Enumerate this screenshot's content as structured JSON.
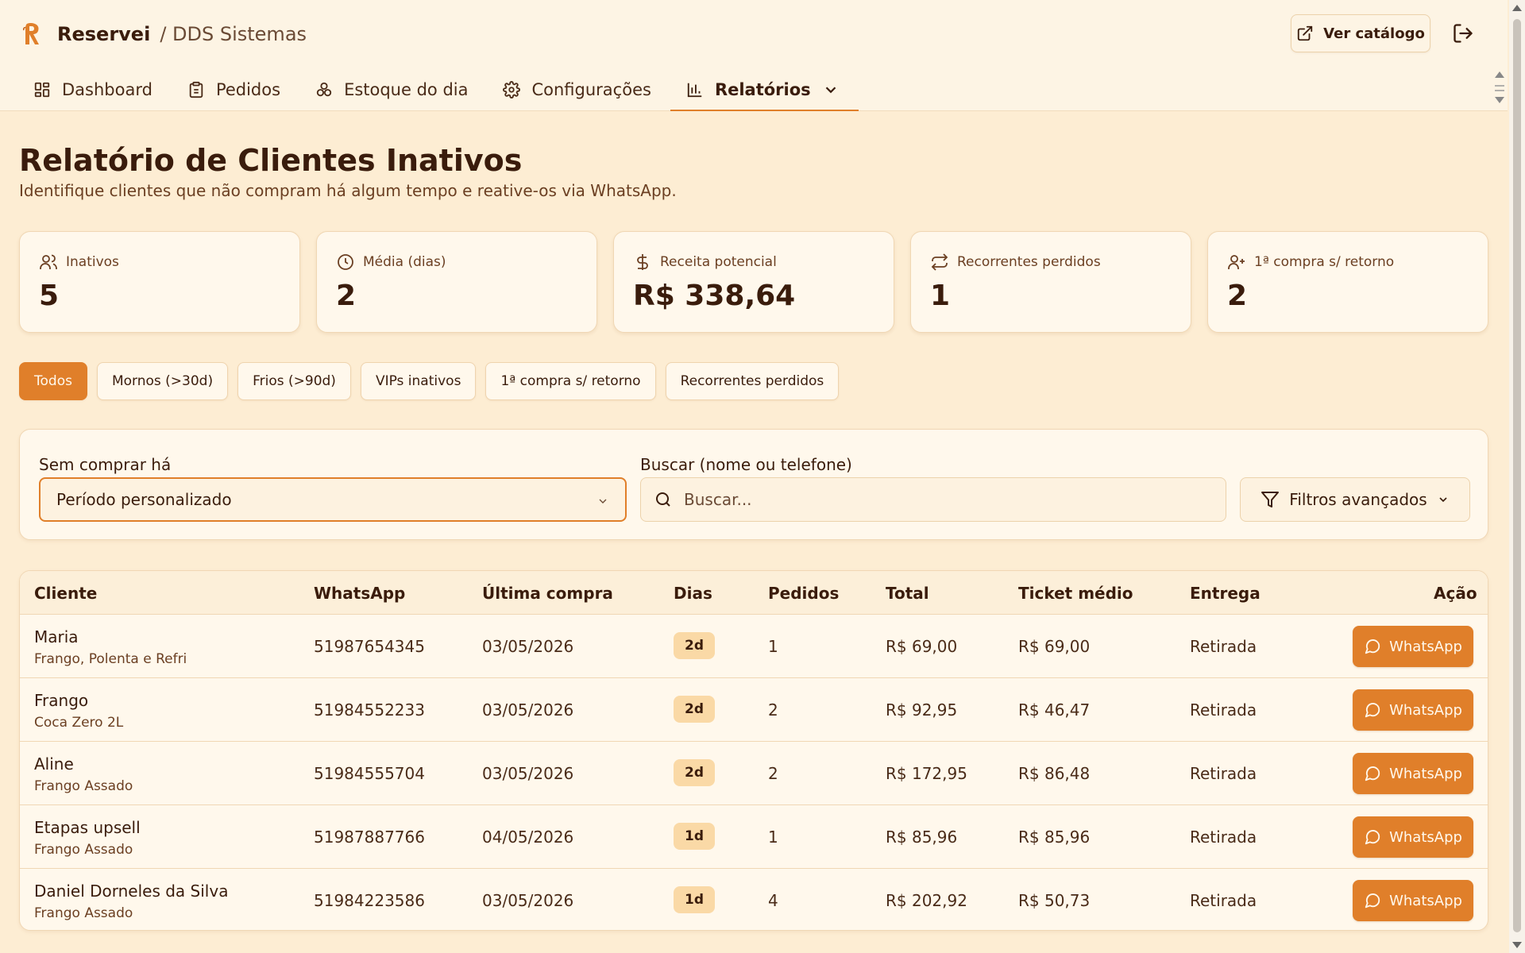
{
  "header": {
    "brand": "Reservei",
    "company": "/ DDS Sistemas",
    "catalog_button": "Ver catálogo"
  },
  "tabs": [
    {
      "label": "Dashboard",
      "icon": "dashboard-icon"
    },
    {
      "label": "Pedidos",
      "icon": "clipboard-icon"
    },
    {
      "label": "Estoque do dia",
      "icon": "boxes-icon"
    },
    {
      "label": "Configurações",
      "icon": "gear-icon"
    },
    {
      "label": "Relatórios",
      "icon": "bar-chart-icon",
      "active": true
    }
  ],
  "page": {
    "title": "Relatório de Clientes Inativos",
    "subtitle": "Identifique clientes que não compram há algum tempo e reative-os via WhatsApp."
  },
  "stats": [
    {
      "label": "Inativos",
      "value": "5",
      "icon": "users-icon"
    },
    {
      "label": "Média (dias)",
      "value": "2",
      "icon": "clock-icon"
    },
    {
      "label": "Receita potencial",
      "value": "R$ 338,64",
      "icon": "dollar-icon"
    },
    {
      "label": "Recorrentes perdidos",
      "value": "1",
      "icon": "repeat-icon"
    },
    {
      "label": "1ª compra s/ retorno",
      "value": "2",
      "icon": "user-plus-icon"
    }
  ],
  "chips": [
    "Todos",
    "Mornos (>30d)",
    "Frios (>90d)",
    "VIPs inativos",
    "1ª compra s/ retorno",
    "Recorrentes perdidos"
  ],
  "filters": {
    "period_label": "Sem comprar há",
    "period_value": "Período personalizado",
    "search_label": "Buscar (nome ou telefone)",
    "search_placeholder": "Buscar...",
    "advanced_button": "Filtros avançados"
  },
  "table": {
    "headers": [
      "Cliente",
      "WhatsApp",
      "Última compra",
      "Dias",
      "Pedidos",
      "Total",
      "Ticket médio",
      "Entrega",
      "Ação"
    ],
    "action_label": "WhatsApp",
    "rows": [
      {
        "name": "Maria",
        "product": "Frango, Polenta e Refri",
        "phone": "51987654345",
        "last": "03/05/2026",
        "days": "2d",
        "orders": "1",
        "total": "R$ 69,00",
        "ticket": "R$ 69,00",
        "delivery": "Retirada"
      },
      {
        "name": "Frango",
        "product": "Coca Zero 2L",
        "phone": "51984552233",
        "last": "03/05/2026",
        "days": "2d",
        "orders": "2",
        "total": "R$ 92,95",
        "ticket": "R$ 46,47",
        "delivery": "Retirada"
      },
      {
        "name": "Aline",
        "product": "Frango Assado",
        "phone": "51984555704",
        "last": "03/05/2026",
        "days": "2d",
        "orders": "2",
        "total": "R$ 172,95",
        "ticket": "R$ 86,48",
        "delivery": "Retirada"
      },
      {
        "name": "Etapas upsell",
        "product": "Frango Assado",
        "phone": "51987887766",
        "last": "04/05/2026",
        "days": "1d",
        "orders": "1",
        "total": "R$ 85,96",
        "ticket": "R$ 85,96",
        "delivery": "Retirada"
      },
      {
        "name": "Daniel Dorneles da Silva",
        "product": "Frango Assado",
        "phone": "51984223586",
        "last": "03/05/2026",
        "days": "1d",
        "orders": "4",
        "total": "R$ 202,92",
        "ticket": "R$ 50,73",
        "delivery": "Retirada"
      }
    ]
  },
  "colors": {
    "accent": "#e07f2a",
    "background": "#fdedd3",
    "card": "#fff8ec",
    "text": "#3a1c0c"
  }
}
